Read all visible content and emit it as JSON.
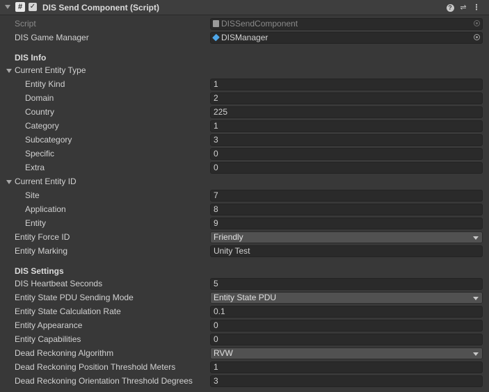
{
  "header": {
    "title": "DIS Send Component (Script)",
    "script_icon": "#",
    "checkbox": "✓",
    "icons": [
      "foldout-arrow-icon",
      "script-icon",
      "help-icon",
      "presets-icon",
      "menu-icon"
    ]
  },
  "script_row": {
    "label": "Script",
    "value": "DISSendComponent"
  },
  "manager_row": {
    "label": "DIS Game Manager",
    "value": "DISManager"
  },
  "dis_info": {
    "heading": "DIS Info",
    "entity_type": {
      "label": "Current Entity Type",
      "kind": {
        "label": "Entity Kind",
        "value": "1"
      },
      "domain": {
        "label": "Domain",
        "value": "2"
      },
      "country": {
        "label": "Country",
        "value": "225"
      },
      "category": {
        "label": "Category",
        "value": "1"
      },
      "subcategory": {
        "label": "Subcategory",
        "value": "3"
      },
      "specific": {
        "label": "Specific",
        "value": "0"
      },
      "extra": {
        "label": "Extra",
        "value": "0"
      }
    },
    "entity_id": {
      "label": "Current Entity ID",
      "site": {
        "label": "Site",
        "value": "7"
      },
      "application": {
        "label": "Application",
        "value": "8"
      },
      "entity": {
        "label": "Entity",
        "value": "9"
      }
    },
    "force_id": {
      "label": "Entity Force ID",
      "value": "Friendly"
    },
    "marking": {
      "label": "Entity Marking",
      "value": "Unity Test"
    }
  },
  "dis_settings": {
    "heading": "DIS Settings",
    "heartbeat": {
      "label": "DIS Heartbeat Seconds",
      "value": "5"
    },
    "pdu_mode": {
      "label": "Entity State PDU Sending Mode",
      "value": "Entity State PDU"
    },
    "calc_rate": {
      "label": "Entity State Calculation Rate",
      "value": "0.1"
    },
    "appearance": {
      "label": "Entity Appearance",
      "value": "0"
    },
    "capabilities": {
      "label": "Entity Capabilities",
      "value": "0"
    },
    "dr_algorithm": {
      "label": "Dead Reckoning Algorithm",
      "value": "RVW"
    },
    "dr_pos_threshold": {
      "label": "Dead Reckoning Position Threshold Meters",
      "value": "1"
    },
    "dr_orient_threshold": {
      "label": "Dead Reckoning Orientation Threshold Degrees",
      "value": "3"
    }
  }
}
